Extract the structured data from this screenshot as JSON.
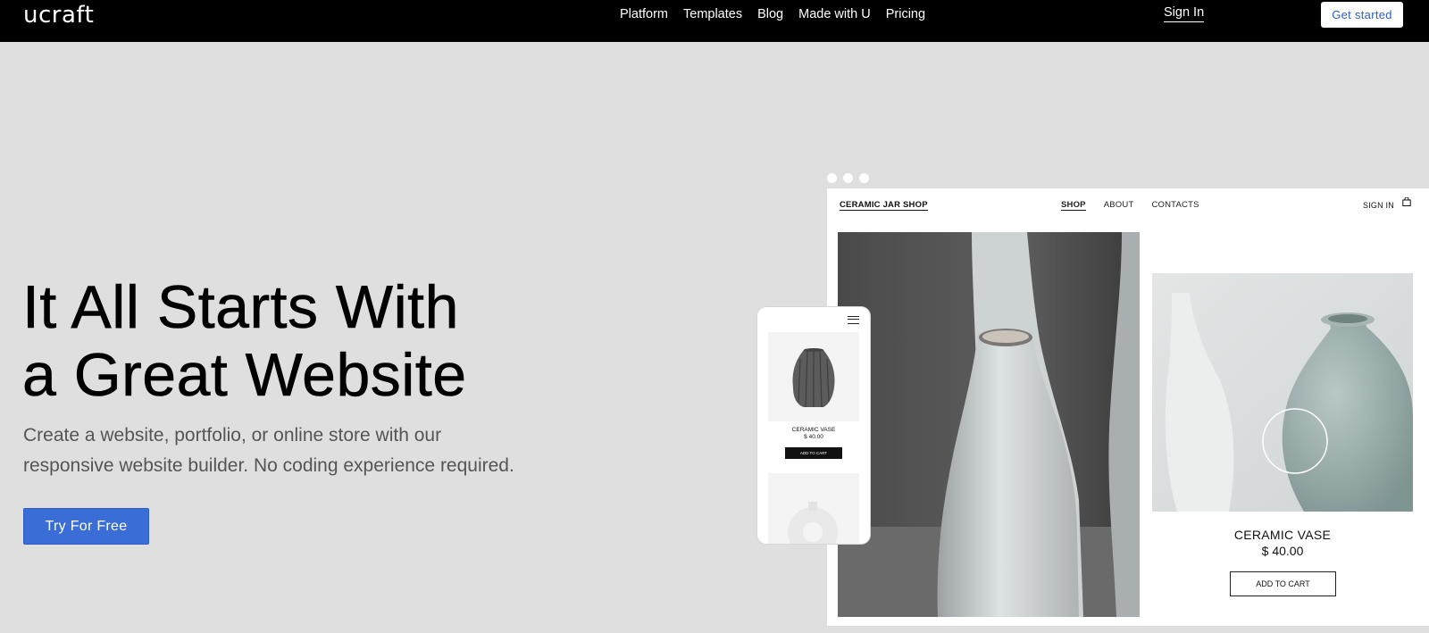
{
  "header": {
    "logo": "ucraft",
    "nav": [
      "Platform",
      "Templates",
      "Blog",
      "Made with U",
      "Pricing"
    ],
    "sign_in": "Sign In",
    "get_started": "Get started"
  },
  "hero": {
    "title_line1": "It All Starts With",
    "title_line2": "a Great Website",
    "subtitle_line1": "Create a website, portfolio, or online store with our",
    "subtitle_line2": "responsive website builder. No coding experience required.",
    "cta": "Try For Free"
  },
  "preview": {
    "shop_name": "CERAMIC JAR SHOP",
    "shop_nav": [
      "SHOP",
      "ABOUT",
      "CONTACTS"
    ],
    "shop_sign_in": "SIGN IN",
    "product_name": "CERAMIC VASE",
    "product_price": "$ 40.00",
    "add_to_cart": "ADD TO CART",
    "mobile": {
      "product_name": "CERAMIC VASE",
      "product_price": "$ 40.00",
      "add_to_cart": "ADD TO CART"
    }
  },
  "colors": {
    "topbar": "#000000",
    "page_bg": "#dfdfdf",
    "accent": "#3a6dd6"
  },
  "icons": [
    "menu-icon",
    "shopping-bag-icon"
  ]
}
